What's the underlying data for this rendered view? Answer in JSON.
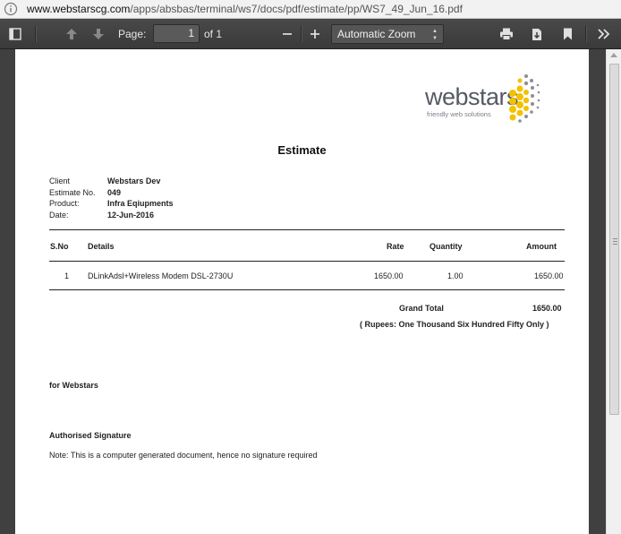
{
  "browser": {
    "url_host": "www.webstarscg.com",
    "url_path": "/apps/absbas/terminal/ws7/docs/pdf/estimate/pp/WS7_49_Jun_16.pdf"
  },
  "toolbar": {
    "page_label": "Page:",
    "page_value": "1",
    "page_of": "of 1",
    "zoom_value": "Automatic Zoom"
  },
  "logo": {
    "word": "webstars",
    "tagline": "friendly web solutions"
  },
  "document": {
    "title": "Estimate",
    "meta": [
      {
        "key": "Client",
        "value": "Webstars Dev"
      },
      {
        "key": "Estimate No.",
        "value": "049"
      },
      {
        "key": "Product:",
        "value": "Infra Eqiupments"
      },
      {
        "key": "Date:",
        "value": "12-Jun-2016"
      }
    ],
    "columns": {
      "sno": "S.No",
      "details": "Details",
      "rate": "Rate",
      "quantity": "Quantity",
      "amount": "Amount"
    },
    "rows": [
      {
        "sno": "1",
        "details": "DLinkAdsl+Wireless Modem DSL-2730U",
        "rate": "1650.00",
        "quantity": "1.00",
        "amount": "1650.00"
      }
    ],
    "grand_total_label": "Grand Total",
    "grand_total_value": "1650.00",
    "amount_words": "( Rupees: One Thousand Six Hundred Fifty Only )",
    "for_company": "for Webstars",
    "signature_label": "Authorised Signature",
    "note": "Note: This is a computer generated document, hence no signature required"
  },
  "colors": {
    "toolbar": "#404040",
    "logo_dots": "#f2c200",
    "logo_text": "#555a63"
  }
}
